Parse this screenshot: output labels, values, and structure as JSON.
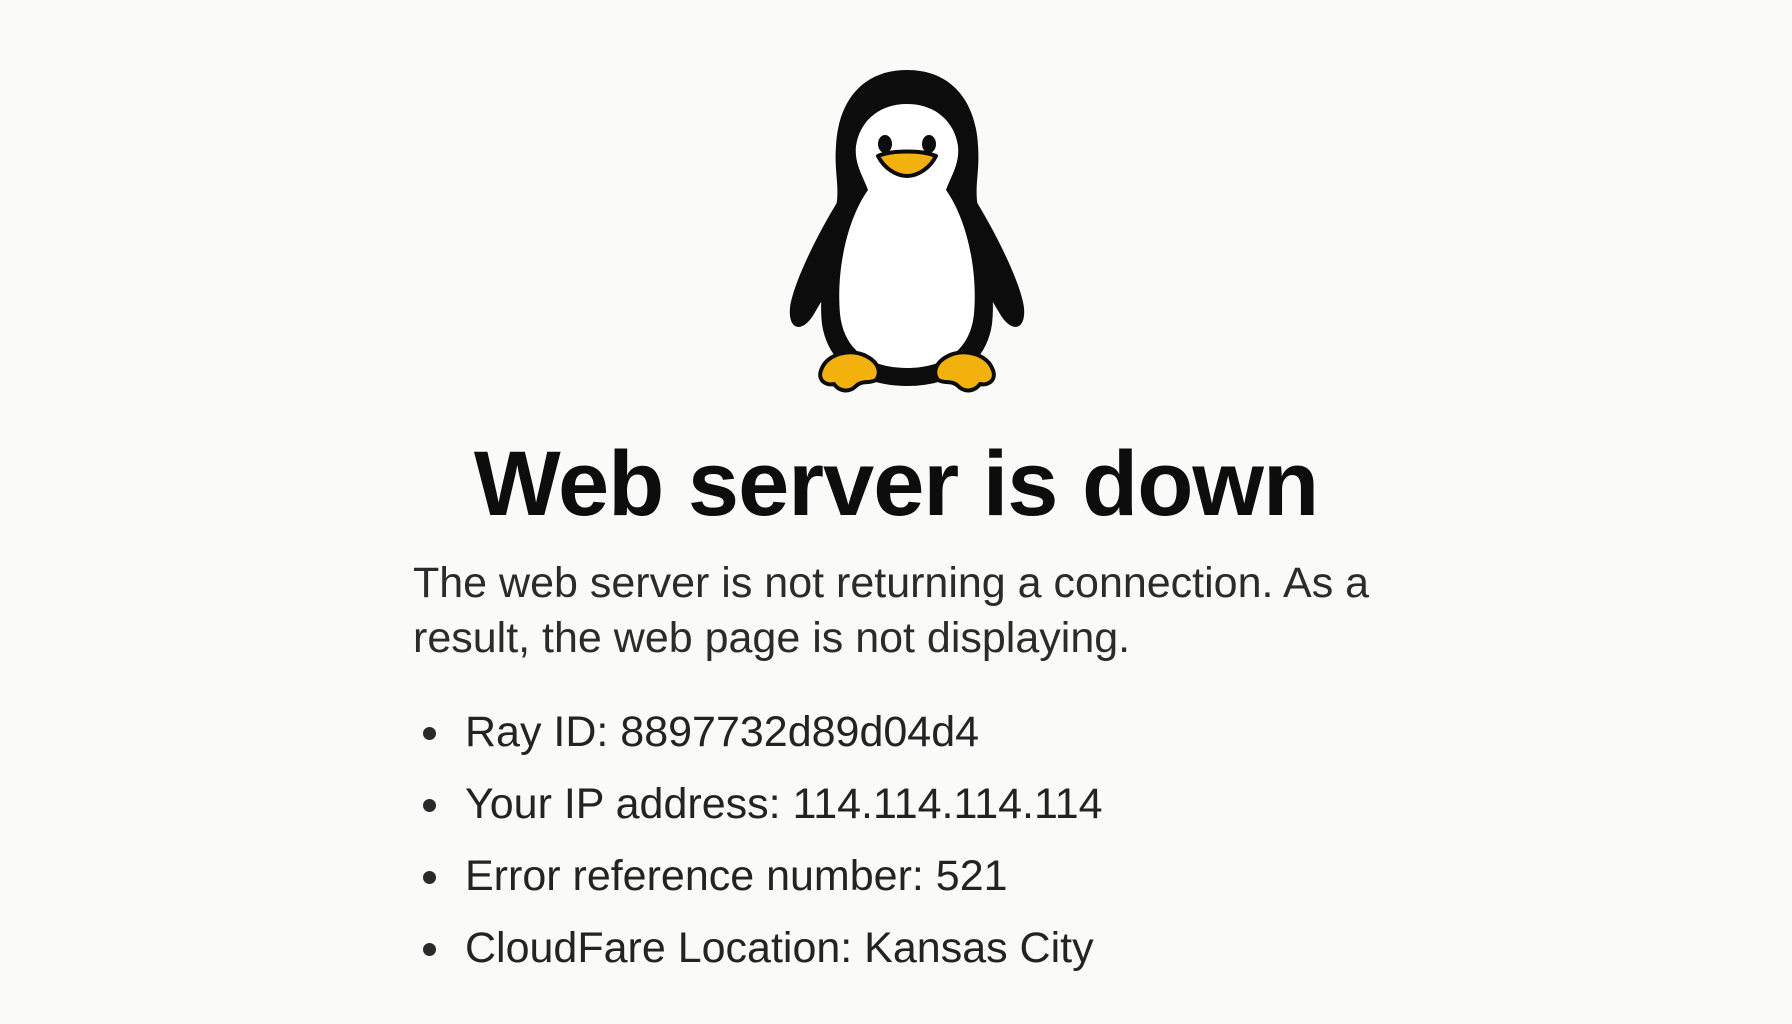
{
  "mascot": {
    "icon": "penguin-icon",
    "colors": {
      "body": "#0c0c0c",
      "belly": "#ffffff",
      "beak_feet": "#f2b10c"
    }
  },
  "error": {
    "title": "Web server is down",
    "message": "The web server is not returning a connection. As a result, the web page is not displaying."
  },
  "details": [
    {
      "text": "Ray ID: 8897732d89d04d4"
    },
    {
      "text": "Your IP address: 114.114.114.114"
    },
    {
      "text": "Error reference number: 521"
    },
    {
      "text": "CloudFare Location: Kansas City"
    }
  ]
}
